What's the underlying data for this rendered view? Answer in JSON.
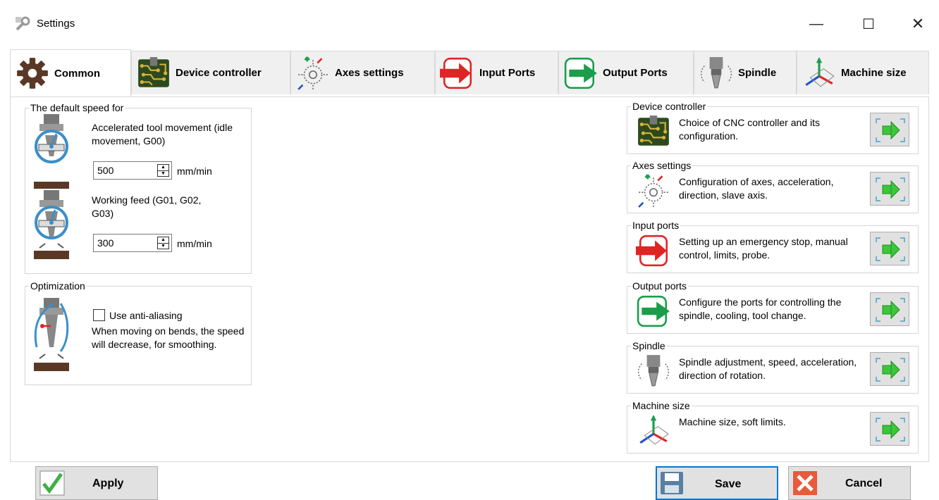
{
  "window": {
    "title": "Settings",
    "minimize": "—",
    "maximize": "☐",
    "close": "✕"
  },
  "tabs": [
    {
      "label": "Common",
      "icon": "gear-icon"
    },
    {
      "label": "Device controller",
      "icon": "circuit-board-icon"
    },
    {
      "label": "Axes settings",
      "icon": "axes-gear-icon"
    },
    {
      "label": "Input Ports",
      "icon": "red-arrow-in-icon"
    },
    {
      "label": "Output Ports",
      "icon": "green-arrow-out-icon"
    },
    {
      "label": "Spindle",
      "icon": "spindle-icon"
    },
    {
      "label": "Machine size",
      "icon": "axes-icon"
    }
  ],
  "default_speed": {
    "title": "The default speed for",
    "rapid_label": "Accelerated tool movement (idle movement, G00)",
    "rapid_value": "500",
    "rapid_unit": "mm/min",
    "feed_label": "Working feed (G01, G02, G03)",
    "feed_value": "300",
    "feed_unit": "mm/min"
  },
  "optimization": {
    "title": "Optimization",
    "checkbox_label": "Use anti-aliasing",
    "checked": false,
    "description": "When moving on bends, the speed will decrease, for smoothing."
  },
  "shortcuts": [
    {
      "title": "Device controller",
      "description": "Choice of CNC controller and its configuration."
    },
    {
      "title": "Axes settings",
      "description": "Configuration of axes, acceleration, direction, slave axis."
    },
    {
      "title": "Input ports",
      "description": "Setting up an emergency stop, manual control, limits, probe."
    },
    {
      "title": "Output ports",
      "description": "Configure the ports for controlling the spindle, cooling, tool change."
    },
    {
      "title": "Spindle",
      "description": "Spindle adjustment, speed, acceleration, direction of rotation."
    },
    {
      "title": "Machine size",
      "description": "Machine size, soft limits."
    }
  ],
  "buttons": {
    "apply": "Apply",
    "save": "Save",
    "cancel": "Cancel"
  },
  "colors": {
    "accent": "#0078d7",
    "input_red": "#e02424",
    "output_green": "#1a9e4b",
    "board": "#2d4a1e",
    "gear": "#5a3826"
  }
}
